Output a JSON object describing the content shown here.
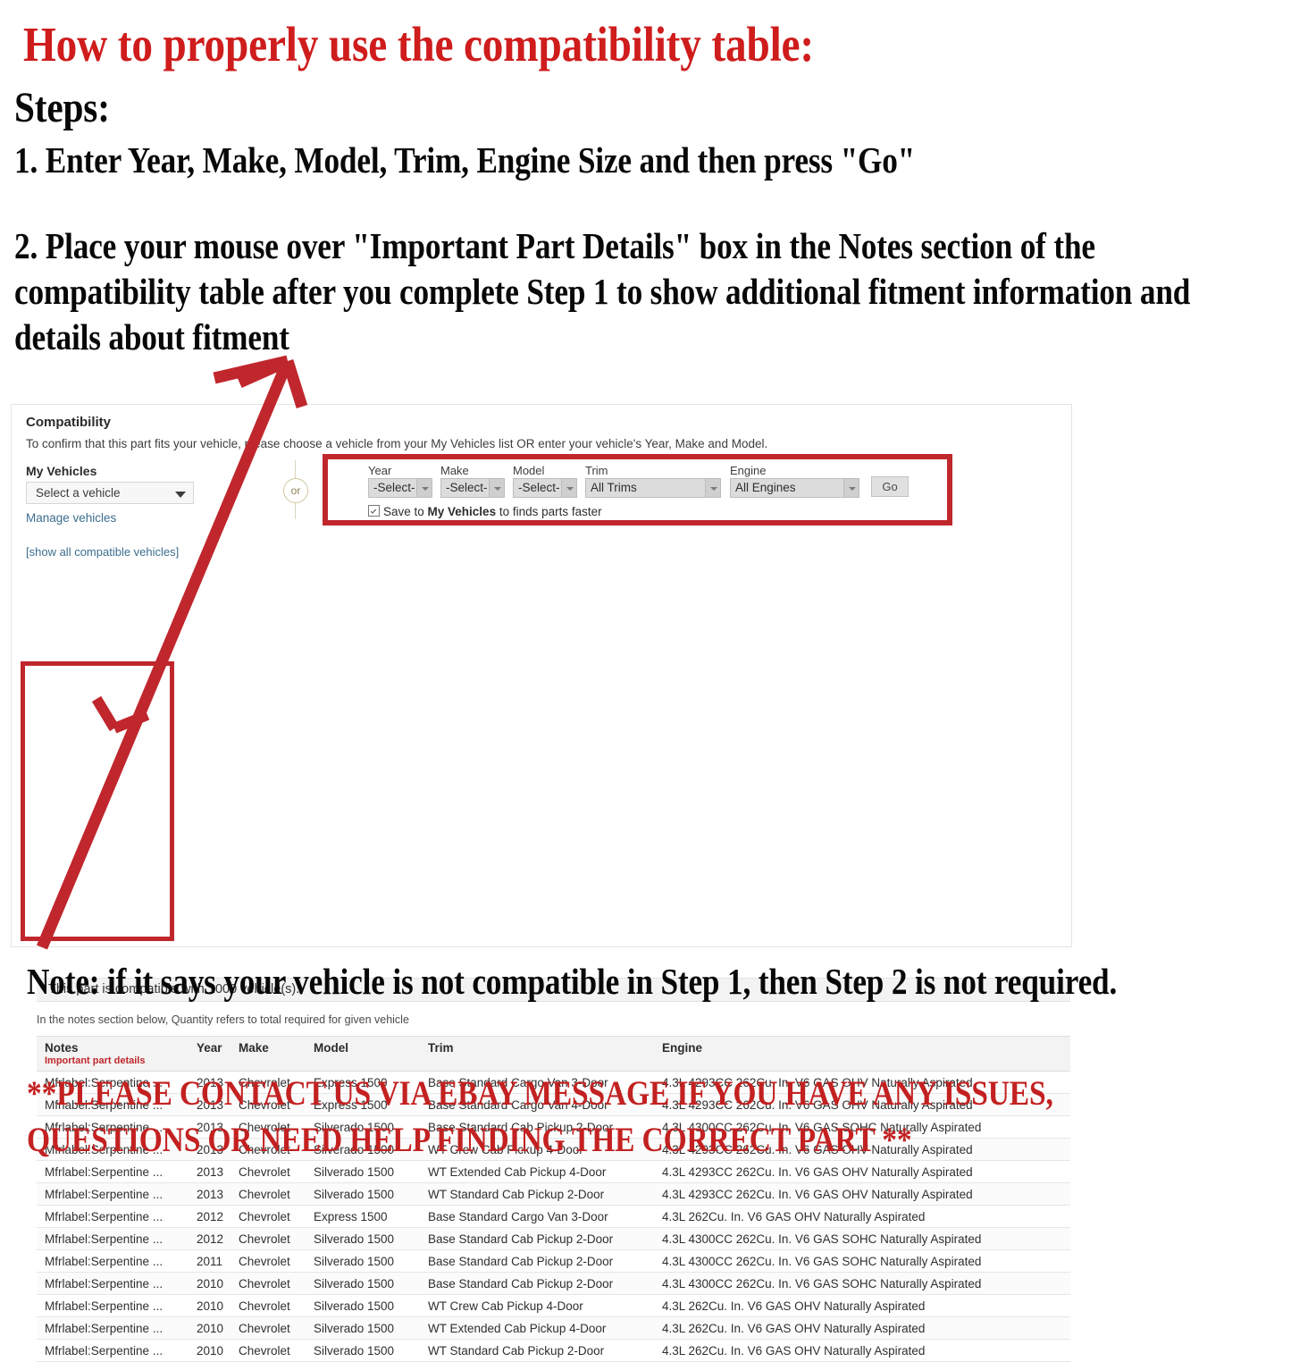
{
  "headline": {
    "title": "How to properly use the compatibility table:",
    "steps_label": "Steps:",
    "step1": "1. Enter Year, Make, Model, Trim, Engine Size and then press \"Go\"",
    "step2": "2. Place your mouse over \"Important Part Details\" box in the Notes section of the compatibility table after you complete Step 1 to show additional fitment information and details about fitment",
    "note": "Note: if it says your vehicle is not compatible in Step 1, then Step 2 is not required.",
    "contact": "**PLEASE CONTACT US VIA EBAY MESSAGE IF YOU HAVE ANY ISSUES, QUESTIONS OR NEED HELP FINDING THE CORRECT PART **"
  },
  "colors": {
    "accent_red": "#cf1c1c",
    "box_red": "#c0272d",
    "link_blue": "#3b6e8f",
    "header_gray": "#f3f3f3"
  },
  "panel": {
    "heading": "Compatibility",
    "subtitle": "To confirm that this part fits your vehicle, please choose a vehicle from your My Vehicles list OR enter your vehicle's Year, Make and Model.",
    "my_vehicles_label": "My Vehicles",
    "my_vehicles_value": "Select a vehicle",
    "manage_vehicles_link": "Manage vehicles",
    "show_all_link": "[show all compatible vehicles]",
    "or_divider": "or",
    "compatible_message": "This part is compatible with 1000 vehicle(s).",
    "quantity_note": "In the notes section below, Quantity refers to total required for given vehicle"
  },
  "finder": {
    "fields": [
      {
        "label": "Year",
        "value": "-Select-"
      },
      {
        "label": "Make",
        "value": "-Select-"
      },
      {
        "label": "Model",
        "value": "-Select-"
      },
      {
        "label": "Trim",
        "value": "All Trims"
      },
      {
        "label": "Engine",
        "value": "All Engines"
      }
    ],
    "go_label": "Go",
    "save_prefix": "Save to ",
    "save_bold": "My Vehicles",
    "save_suffix": " to finds parts faster",
    "save_checked": true
  },
  "table": {
    "headers": {
      "notes": "Notes",
      "notes_sub": "Important part details",
      "year": "Year",
      "make": "Make",
      "model": "Model",
      "trim": "Trim",
      "engine": "Engine"
    },
    "rows": [
      {
        "notes": "Mfrlabel:Serpentine ...",
        "year": "2013",
        "make": "Chevrolet",
        "model": "Express 1500",
        "trim": "Base Standard Cargo Van 3-Door",
        "engine": "4.3L 4293CC 262Cu. In. V6 GAS OHV Naturally Aspirated"
      },
      {
        "notes": "Mfrlabel:Serpentine ...",
        "year": "2013",
        "make": "Chevrolet",
        "model": "Express 1500",
        "trim": "Base Standard Cargo Van 4-Door",
        "engine": "4.3L 4293CC 262Cu. In. V6 GAS OHV Naturally Aspirated"
      },
      {
        "notes": "Mfrlabel:Serpentine ...",
        "year": "2013",
        "make": "Chevrolet",
        "model": "Silverado 1500",
        "trim": "Base Standard Cab Pickup 2-Door",
        "engine": "4.3L 4300CC 262Cu. In. V6 GAS SOHC Naturally Aspirated"
      },
      {
        "notes": "Mfrlabel:Serpentine ...",
        "year": "2013",
        "make": "Chevrolet",
        "model": "Silverado 1500",
        "trim": "WT Crew Cab Pickup 4-Door",
        "engine": "4.3L 4293CC 262Cu. In. V6 GAS OHV Naturally Aspirated"
      },
      {
        "notes": "Mfrlabel:Serpentine ...",
        "year": "2013",
        "make": "Chevrolet",
        "model": "Silverado 1500",
        "trim": "WT Extended Cab Pickup 4-Door",
        "engine": "4.3L 4293CC 262Cu. In. V6 GAS OHV Naturally Aspirated"
      },
      {
        "notes": "Mfrlabel:Serpentine ...",
        "year": "2013",
        "make": "Chevrolet",
        "model": "Silverado 1500",
        "trim": "WT Standard Cab Pickup 2-Door",
        "engine": "4.3L 4293CC 262Cu. In. V6 GAS OHV Naturally Aspirated"
      },
      {
        "notes": "Mfrlabel:Serpentine ...",
        "year": "2012",
        "make": "Chevrolet",
        "model": "Express 1500",
        "trim": "Base Standard Cargo Van 3-Door",
        "engine": "4.3L 262Cu. In. V6 GAS OHV Naturally Aspirated"
      },
      {
        "notes": "Mfrlabel:Serpentine ...",
        "year": "2012",
        "make": "Chevrolet",
        "model": "Silverado 1500",
        "trim": "Base Standard Cab Pickup 2-Door",
        "engine": "4.3L 4300CC 262Cu. In. V6 GAS SOHC Naturally Aspirated"
      },
      {
        "notes": "Mfrlabel:Serpentine ...",
        "year": "2011",
        "make": "Chevrolet",
        "model": "Silverado 1500",
        "trim": "Base Standard Cab Pickup 2-Door",
        "engine": "4.3L 4300CC 262Cu. In. V6 GAS SOHC Naturally Aspirated"
      },
      {
        "notes": "Mfrlabel:Serpentine ...",
        "year": "2010",
        "make": "Chevrolet",
        "model": "Silverado 1500",
        "trim": "Base Standard Cab Pickup 2-Door",
        "engine": "4.3L 4300CC 262Cu. In. V6 GAS SOHC Naturally Aspirated"
      },
      {
        "notes": "Mfrlabel:Serpentine ...",
        "year": "2010",
        "make": "Chevrolet",
        "model": "Silverado 1500",
        "trim": "WT Crew Cab Pickup 4-Door",
        "engine": "4.3L 262Cu. In. V6 GAS OHV Naturally Aspirated"
      },
      {
        "notes": "Mfrlabel:Serpentine ...",
        "year": "2010",
        "make": "Chevrolet",
        "model": "Silverado 1500",
        "trim": "WT Extended Cab Pickup 4-Door",
        "engine": "4.3L 262Cu. In. V6 GAS OHV Naturally Aspirated"
      },
      {
        "notes": "Mfrlabel:Serpentine ...",
        "year": "2010",
        "make": "Chevrolet",
        "model": "Silverado 1500",
        "trim": "WT Standard Cab Pickup 2-Door",
        "engine": "4.3L 262Cu. In. V6 GAS OHV Naturally Aspirated"
      }
    ]
  }
}
